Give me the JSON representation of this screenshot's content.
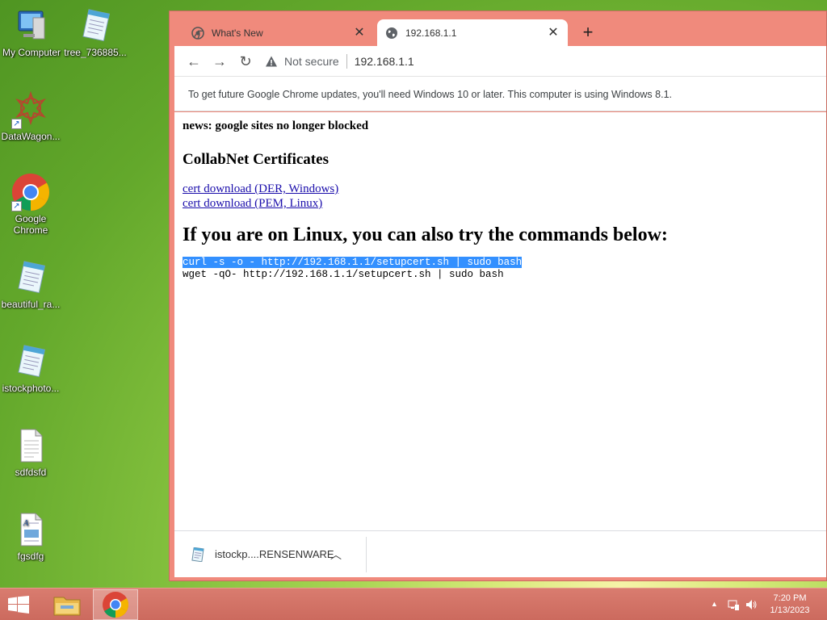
{
  "desktop": {
    "icons": [
      {
        "label": "My Computer"
      },
      {
        "label": "tree_736885..."
      },
      {
        "label": "DataWagon..."
      },
      {
        "label": "Google Chrome"
      },
      {
        "label": "beautiful_ra..."
      },
      {
        "label": "istockphoto..."
      },
      {
        "label": "sdfdsfd"
      },
      {
        "label": "fgsdfg"
      }
    ]
  },
  "browser": {
    "tabs": [
      {
        "title": "What's New",
        "icon": "chrome-icon",
        "active": false
      },
      {
        "title": "192.168.1.1",
        "icon": "globe-icon",
        "active": true
      }
    ],
    "omnibox": {
      "security_label": "Not secure",
      "url": "192.168.1.1"
    },
    "infobar_text": "To get future Google Chrome updates, you'll need Windows 10 or later. This computer is using Windows 8.1.",
    "download": {
      "filename": "istockp....RENSENWARE"
    }
  },
  "page": {
    "news": "news: google sites no longer blocked",
    "certs_heading": "CollabNet Certificates",
    "links": [
      "cert download (DER, Windows)",
      "cert download (PEM, Linux)"
    ],
    "linux_heading": "If you are on Linux, you can also try the commands below:",
    "commands": [
      "curl -s -o - http://192.168.1.1/setupcert.sh | sudo bash",
      "wget -qO- http://192.168.1.1/setupcert.sh | sudo bash"
    ]
  },
  "taskbar": {
    "time": "7:20 PM",
    "date": "1/13/2023"
  },
  "colors": {
    "window_frame": "#f08a7c",
    "taskbar": "#cc6a5e",
    "selection": "#3390ff",
    "link": "#1a0dab"
  }
}
